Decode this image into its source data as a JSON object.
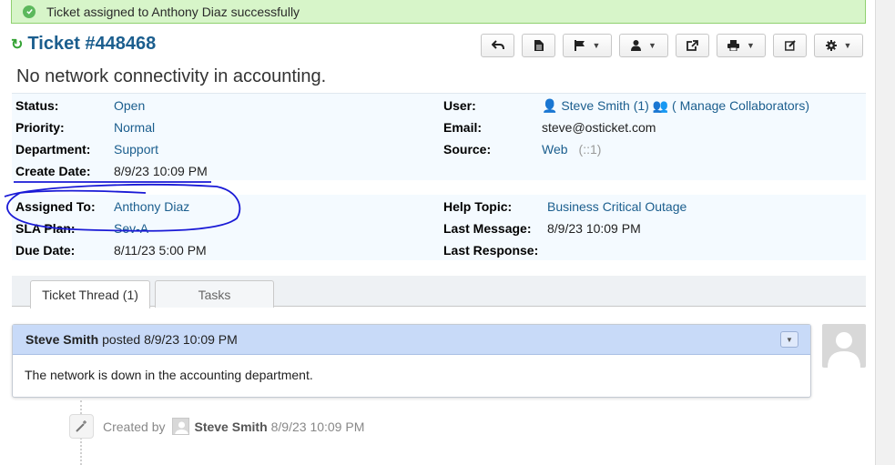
{
  "notice": {
    "text": "Ticket assigned to Anthony Diaz successfully",
    "icon": "check-circle-icon",
    "color": "#5cb85c"
  },
  "ticket": {
    "title": "Ticket #448468",
    "subject": "No network connectivity in accounting.",
    "accent": "#1b5e8e"
  },
  "toolbar": {
    "buttons": [
      {
        "icon": "back-arrow-icon"
      },
      {
        "icon": "document-icon"
      },
      {
        "icon": "flag-icon",
        "dropdown": true
      },
      {
        "icon": "user-icon",
        "dropdown": true
      },
      {
        "icon": "share-icon"
      },
      {
        "icon": "print-icon",
        "dropdown": true
      },
      {
        "icon": "edit-icon"
      },
      {
        "icon": "gear-icon",
        "dropdown": true
      }
    ]
  },
  "info": {
    "status_label": "Status:",
    "status": "Open",
    "priority_label": "Priority:",
    "priority": "Normal",
    "department_label": "Department:",
    "department": "Support",
    "create_date_label": "Create Date:",
    "create_date": "8/9/23 10:09 PM",
    "user_label": "User:",
    "user": "Steve Smith (1)",
    "manage_collaborators": "( Manage Collaborators)",
    "email_label": "Email:",
    "email": "steve@osticket.com",
    "source_label": "Source:",
    "source": "Web",
    "source_ip": "(::1)",
    "assigned_label": "Assigned To:",
    "assigned": "Anthony Diaz",
    "sla_label": "SLA Plan:",
    "sla": "Sev-A",
    "due_label": "Due Date:",
    "due": "8/11/23 5:00 PM",
    "topic_label": "Help Topic:",
    "topic": "Business Critical Outage",
    "last_message_label": "Last Message:",
    "last_message": "8/9/23 10:09 PM",
    "last_response_label": "Last Response:",
    "last_response": ""
  },
  "tabs": {
    "thread": "Ticket Thread (1)",
    "tasks": "Tasks"
  },
  "thread": {
    "author": "Steve Smith",
    "posted": "posted 8/9/23 10:09 PM",
    "body": "The network is down in the accounting department."
  },
  "event": {
    "prefix": "Created by",
    "author": "Steve Smith",
    "time": "8/9/23 10:09 PM"
  }
}
